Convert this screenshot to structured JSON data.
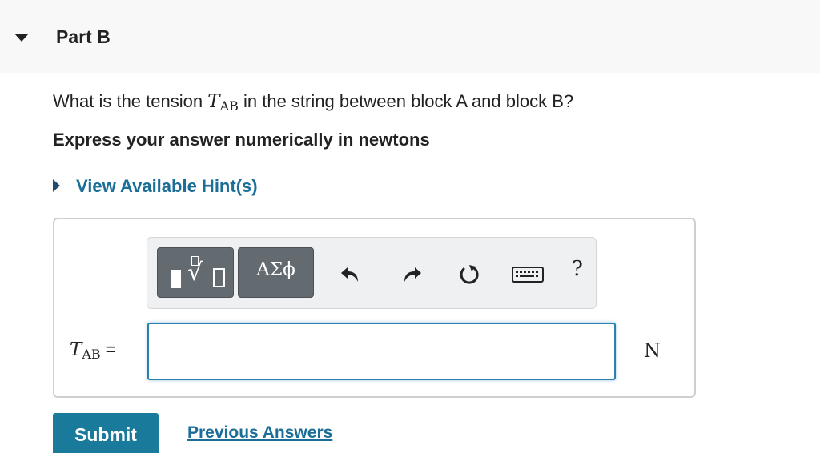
{
  "part": {
    "title": "Part B"
  },
  "question": {
    "prefix": "What is the tension ",
    "var_main": "T",
    "var_sub": "AB",
    "suffix": " in the string between block A and block B?"
  },
  "instruction": "Express your answer numerically in newtons",
  "hint": {
    "label": "View Available Hint(s)"
  },
  "toolbar": {
    "symbols_label": "ΑΣϕ",
    "help_label": "?"
  },
  "answer": {
    "var_main": "T",
    "var_sub": "AB",
    "equals": "=",
    "value": "",
    "unit": "N"
  },
  "actions": {
    "submit_label": "Submit",
    "previous_answers_label": "Previous Answers"
  },
  "icons": {
    "collapse": "triangle-down-icon",
    "hint": "triangle-right-icon",
    "templates": "templates-icon",
    "undo": "undo-icon",
    "redo": "redo-icon",
    "reset": "reset-icon",
    "keyboard": "keyboard-icon"
  }
}
